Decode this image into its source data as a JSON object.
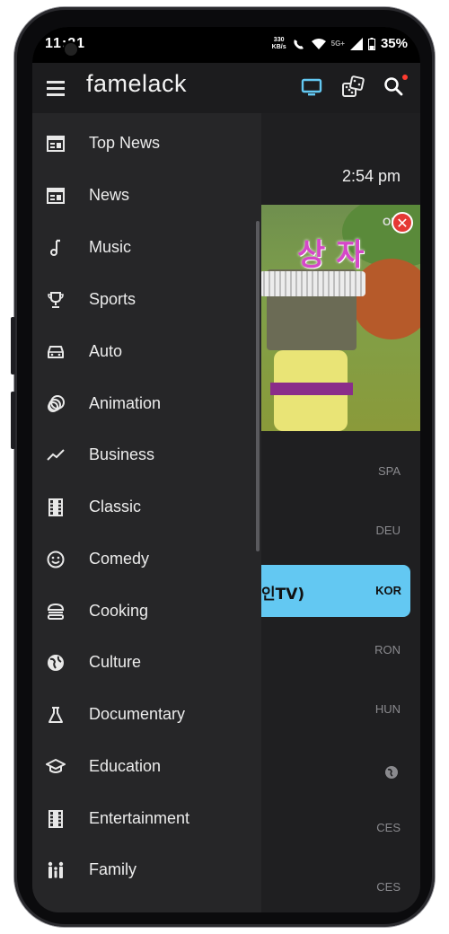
{
  "status_bar": {
    "time": "11:21",
    "net_speed_top": "330",
    "net_speed_unit": "KB/s",
    "network": "5G+",
    "battery": "35%"
  },
  "app_bar": {
    "brand": "famelack",
    "icons": [
      "menu-icon",
      "tv-icon",
      "dice-icon",
      "search-icon"
    ]
  },
  "drawer": {
    "items": [
      {
        "label": "Top News",
        "icon": "newspaper-icon"
      },
      {
        "label": "News",
        "icon": "newspaper-icon"
      },
      {
        "label": "Music",
        "icon": "music-note-icon"
      },
      {
        "label": "Sports",
        "icon": "trophy-icon"
      },
      {
        "label": "Auto",
        "icon": "car-icon"
      },
      {
        "label": "Animation",
        "icon": "animation-icon"
      },
      {
        "label": "Business",
        "icon": "trending-icon"
      },
      {
        "label": "Classic",
        "icon": "film-icon"
      },
      {
        "label": "Comedy",
        "icon": "smiley-icon"
      },
      {
        "label": "Cooking",
        "icon": "burger-icon"
      },
      {
        "label": "Culture",
        "icon": "globe-icon"
      },
      {
        "label": "Documentary",
        "icon": "flask-icon"
      },
      {
        "label": "Education",
        "icon": "graduation-cap-icon"
      },
      {
        "label": "Entertainment",
        "icon": "film-icon"
      },
      {
        "label": "Family",
        "icon": "family-icon"
      }
    ]
  },
  "content": {
    "clock": "2:54 pm",
    "video_overlay_text": "상 자",
    "video_badge": "OB",
    "highlight": {
      "name": "인TV)",
      "code": "KOR"
    },
    "languages": [
      "SPA",
      "DEU",
      "RON",
      "HUN",
      "CES",
      "CES"
    ]
  },
  "colors": {
    "accent": "#63c8f2",
    "drawer_bg": "#262628",
    "appbar_bg": "#1c1c1e",
    "close_red": "#e53935"
  }
}
